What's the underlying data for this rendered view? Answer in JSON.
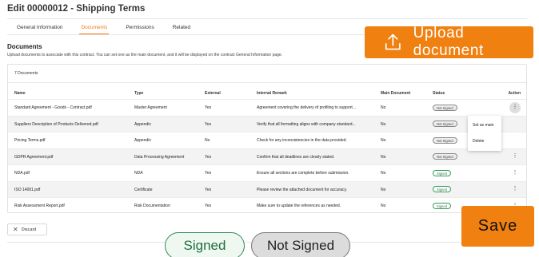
{
  "page": {
    "title": "Edit 00000012 - Shipping Terms"
  },
  "tabs": [
    {
      "label": "General Information",
      "active": false
    },
    {
      "label": "Documents",
      "active": true
    },
    {
      "label": "Permissions",
      "active": false
    },
    {
      "label": "Related",
      "active": false
    }
  ],
  "documents": {
    "heading": "Documents",
    "description": "Upload documents to associate with this contract. You can set one as the main document, and it will be displayed on the contract General Information page.",
    "upload_label": "Upload document",
    "count_label": "7 Documents",
    "columns": {
      "name": "Name",
      "type": "Type",
      "external": "External",
      "remark": "Internal Remark",
      "main": "Main Document",
      "status": "Status",
      "action": "Action"
    },
    "rows": [
      {
        "name": "Standard Agreement - Goods - Contract.pdf",
        "type": "Master Agreement",
        "external": "Yes",
        "remark": "Agreement covering the delivery of profiling to support...",
        "main": "No",
        "status": "Not Signed"
      },
      {
        "name": "Suppliers Description of Products Delivered.pdf",
        "type": "Appendix",
        "external": "Yes",
        "remark": "Verify that all formatting aligns with company standard...",
        "main": "No",
        "status": "Not Signed"
      },
      {
        "name": "Pricing Terms.pdf",
        "type": "Appendix",
        "external": "No",
        "remark": "Check for any inconsistencies in the data provided.",
        "main": "No",
        "status": "Not Signed"
      },
      {
        "name": "GDPR Agreement.pdf",
        "type": "Data Processing Agreement",
        "external": "Yes",
        "remark": "Confirm that all deadlines are clearly stated.",
        "main": "No",
        "status": "Not Signed"
      },
      {
        "name": "NDA.pdf",
        "type": "NDA",
        "external": "Yes",
        "remark": "Ensure all sections are complete before submission.",
        "main": "No",
        "status": "Signed"
      },
      {
        "name": "ISO 14001.pdf",
        "type": "Certificate",
        "external": "Yes",
        "remark": "Please review the attached document for accuracy.",
        "main": "No",
        "status": "Signed"
      },
      {
        "name": "Risk Assessment Report.pdf",
        "type": "Risk Documentation",
        "external": "Yes",
        "remark": "Make sure to update the references as needed.",
        "main": "No",
        "status": "Signed"
      }
    ],
    "action_icon": "more-vertical-icon",
    "row_menu": {
      "set_main": "Set as main",
      "delete": "Delete"
    }
  },
  "footer": {
    "discard_label": "Discard",
    "discard_icon": "close-icon",
    "save_label": "Save"
  },
  "status_legend": {
    "signed": "Signed",
    "not_signed": "Not Signed"
  },
  "colors": {
    "accent": "#f08010",
    "signed": "#2f8a56",
    "not_signed": "#888888"
  }
}
